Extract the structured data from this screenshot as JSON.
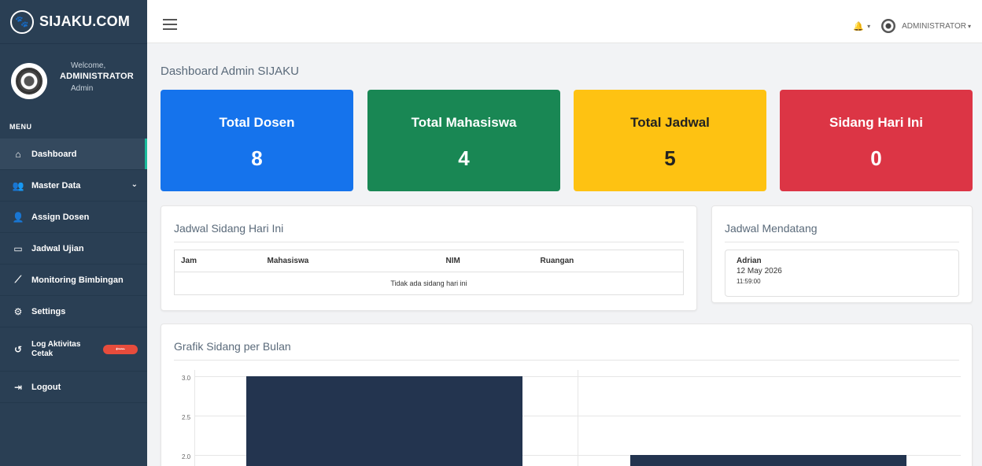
{
  "sidebar": {
    "brand": "SIJAKU.COM",
    "welcome": "Welcome,",
    "user": "ADMINISTRATOR",
    "role": "Admin",
    "menu_title": "MENU",
    "items": [
      {
        "label": "Dashboard",
        "icon": "home-icon"
      },
      {
        "label": "Master Data",
        "icon": "users-icon"
      },
      {
        "label": "Assign Dosen",
        "icon": "user-plus-icon"
      },
      {
        "label": "Jadwal Ujian",
        "icon": "calendar-icon"
      },
      {
        "label": "Monitoring Bimbingan",
        "icon": "chart-line-icon"
      },
      {
        "label": "Settings",
        "icon": "gear-icon"
      },
      {
        "label_line1": "Log Aktivitas",
        "label_line2": "Cetak",
        "icon": "history-icon"
      },
      {
        "label": "Logout",
        "icon": "logout-icon"
      }
    ]
  },
  "topbar": {
    "user": "ADMINISTRATOR"
  },
  "page": {
    "title": "Dashboard Admin SIJAKU"
  },
  "stats": [
    {
      "label": "Total Dosen",
      "value": "8",
      "color": "#1573ec"
    },
    {
      "label": "Total Mahasiswa",
      "value": "4",
      "color": "#198754"
    },
    {
      "label": "Total Jadwal",
      "value": "5",
      "color": "#fec212"
    },
    {
      "label": "Sidang Hari Ini",
      "value": "0",
      "color": "#dc3545"
    }
  ],
  "today": {
    "title": "Jadwal Sidang Hari Ini",
    "headers": [
      "Jam",
      "Mahasiswa",
      "NIM",
      "Ruangan"
    ],
    "empty": "Tidak ada sidang hari ini"
  },
  "upcoming": {
    "title": "Jadwal Mendatang",
    "items": [
      {
        "name": "Adrian",
        "date": "12 May 2026",
        "time": "11:59:00"
      }
    ]
  },
  "chart": {
    "title": "Grafik Sidang per Bulan"
  },
  "chart_data": {
    "type": "bar",
    "values": [
      3,
      2
    ],
    "ylim": [
      0,
      3
    ],
    "ytick_labels": [
      "3.0",
      "2.5",
      "2.0"
    ],
    "bar_color": "#23344f",
    "grid": true
  }
}
